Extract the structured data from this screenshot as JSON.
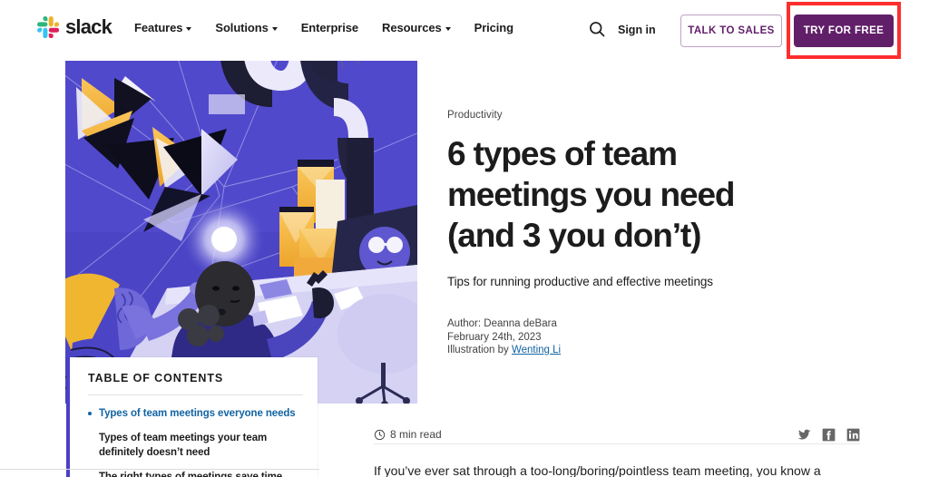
{
  "site": {
    "brand": "slack",
    "logo_colors": {
      "green": "#2eb67d",
      "blue": "#36c5f0",
      "red": "#e01e5a",
      "yellow": "#ecb22e"
    }
  },
  "header": {
    "nav": [
      {
        "label": "Features",
        "has_dropdown": true
      },
      {
        "label": "Solutions",
        "has_dropdown": true
      },
      {
        "label": "Enterprise",
        "has_dropdown": false
      },
      {
        "label": "Resources",
        "has_dropdown": true
      },
      {
        "label": "Pricing",
        "has_dropdown": false
      }
    ],
    "search_icon": "search-icon",
    "signin_label": "Sign in",
    "talk_to_sales_label": "TALK TO SALES",
    "try_for_free_label": "TRY FOR FREE",
    "accent_purple": "#611f69",
    "highlight_color": "#ff2d2d",
    "highlighted_element": "try-for-free-button"
  },
  "article": {
    "category": "Productivity",
    "title": "6 types of team meetings you need (and 3 you don’t)",
    "subtitle": "Tips for running productive and effective meetings",
    "author_line": "Author: Deanna deBara",
    "date_line": "February 24th, 2023",
    "illustration_prefix": "Illustration by ",
    "illustrator": "Wenting Li",
    "read_time": "8 min read",
    "clock_icon": "clock-icon",
    "lede": "If you’ve ever sat through a too-long/boring/pointless team meeting, you know a"
  },
  "social": [
    {
      "name": "twitter-icon",
      "label": "Twitter"
    },
    {
      "name": "facebook-icon",
      "label": "Facebook"
    },
    {
      "name": "linkedin-icon",
      "label": "LinkedIn"
    }
  ],
  "toc": {
    "heading": "TABLE OF CONTENTS",
    "items": [
      {
        "label": "Types of team meetings everyone needs",
        "active": true
      },
      {
        "label": "Types of team meetings your team definitely doesn’t need",
        "active": false
      },
      {
        "label": "The right types of meetings save time",
        "active": false
      }
    ],
    "accent": "#4a40c4"
  },
  "hero": {
    "alt": "Illustration of people at a meeting table with floating geometric shapes",
    "background": "#4b45c6",
    "palette": [
      "#4b45c6",
      "#6f68d8",
      "#f5b335",
      "#1a1a2e",
      "#b9b6ec",
      "#e8e7f8"
    ]
  }
}
